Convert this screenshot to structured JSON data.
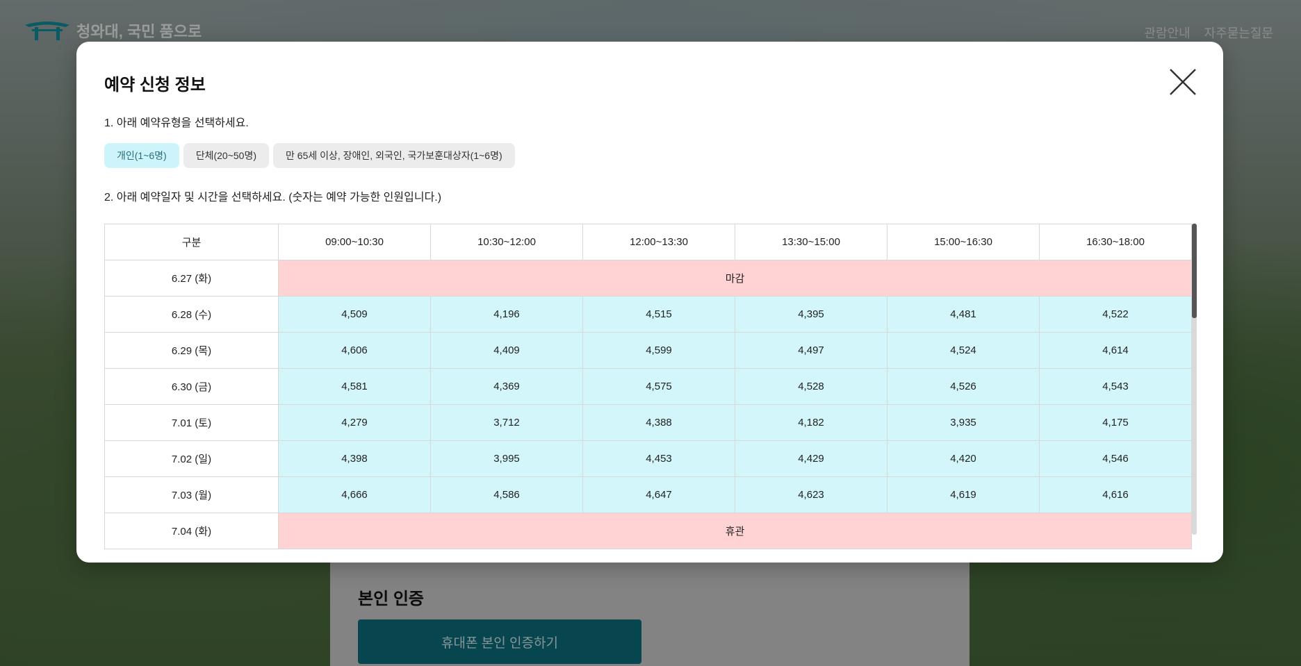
{
  "header": {
    "logo_text": "청와대, 국민 품으로",
    "links": [
      "관람안내",
      "자주묻는질문"
    ]
  },
  "modal": {
    "title": "예약 신청 정보",
    "step1": "1. 아래 예약유형을 선택하세요.",
    "types": [
      {
        "label": "개인(1~6명)",
        "selected": true
      },
      {
        "label": "단체(20~50명)",
        "selected": false
      },
      {
        "label": "만 65세 이상, 장애인, 외국인, 국가보훈대상자(1~6명)",
        "selected": false
      }
    ],
    "step2": "2. 아래 예약일자 및 시간을 선택하세요. (숫자는 예약 가능한 인원입니다.)",
    "table": {
      "headers": [
        "구분",
        "09:00~10:30",
        "10:30~12:00",
        "12:00~13:30",
        "13:30~15:00",
        "15:00~16:30",
        "16:30~18:00"
      ],
      "rows": [
        {
          "date": "6.27 (화)",
          "status": "마감"
        },
        {
          "date": "6.28 (수)",
          "values": [
            "4,509",
            "4,196",
            "4,515",
            "4,395",
            "4,481",
            "4,522"
          ]
        },
        {
          "date": "6.29 (목)",
          "values": [
            "4,606",
            "4,409",
            "4,599",
            "4,497",
            "4,524",
            "4,614"
          ]
        },
        {
          "date": "6.30 (금)",
          "values": [
            "4,581",
            "4,369",
            "4,575",
            "4,528",
            "4,526",
            "4,543"
          ]
        },
        {
          "date": "7.01 (토)",
          "values": [
            "4,279",
            "3,712",
            "4,388",
            "4,182",
            "3,935",
            "4,175"
          ]
        },
        {
          "date": "7.02 (일)",
          "values": [
            "4,398",
            "3,995",
            "4,453",
            "4,429",
            "4,420",
            "4,546"
          ]
        },
        {
          "date": "7.03 (월)",
          "values": [
            "4,666",
            "4,586",
            "4,647",
            "4,623",
            "4,619",
            "4,616"
          ]
        },
        {
          "date": "7.04 (화)",
          "status": "휴관"
        }
      ]
    }
  },
  "page": {
    "verify_title": "본인 인증",
    "verify_button": "휴대폰 본인 인증하기"
  },
  "colors": {
    "available": "#d3f6fb",
    "closed": "#ffd3d3",
    "accent": "#0b6b7a"
  }
}
